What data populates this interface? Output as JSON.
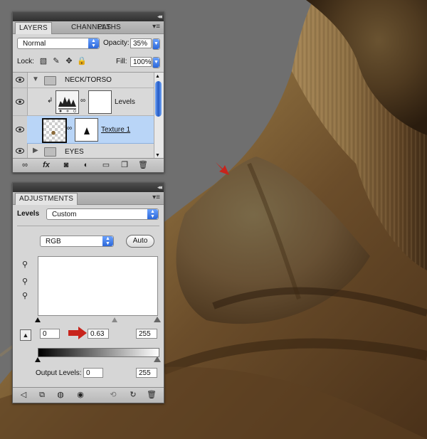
{
  "layers_panel": {
    "tabs": [
      {
        "label": "LAYERS",
        "active": true
      },
      {
        "label": "CHANNELS",
        "active": false
      },
      {
        "label": "PATHS",
        "active": false
      }
    ],
    "blend_mode": "Normal",
    "opacity_label": "Opacity:",
    "opacity_value": "35%",
    "lock_label": "Lock:",
    "fill_label": "Fill:",
    "fill_value": "100%",
    "layers": [
      {
        "name": "NECK/TORSO",
        "kind": "group",
        "expanded": true
      },
      {
        "name": "Levels",
        "kind": "adjustment"
      },
      {
        "name": "Texture 1",
        "kind": "pixel",
        "selected": true
      },
      {
        "name": "EYES",
        "kind": "group",
        "expanded": false
      }
    ]
  },
  "adjustments_panel": {
    "tab": "ADJUSTMENTS",
    "levels_label": "Levels",
    "preset_value": "Custom",
    "channel_value": "RGB",
    "auto_label": "Auto",
    "input_black": "0",
    "input_gamma": "0.63",
    "input_white": "255",
    "output_label": "Output Levels:",
    "output_black": "0",
    "output_white": "255"
  },
  "colors": {
    "panel_bg": "#d6d6d6",
    "selected_row": "#b9d5f7",
    "accent_blue": "#2c67d8",
    "annotation_red": "#c8241c"
  }
}
